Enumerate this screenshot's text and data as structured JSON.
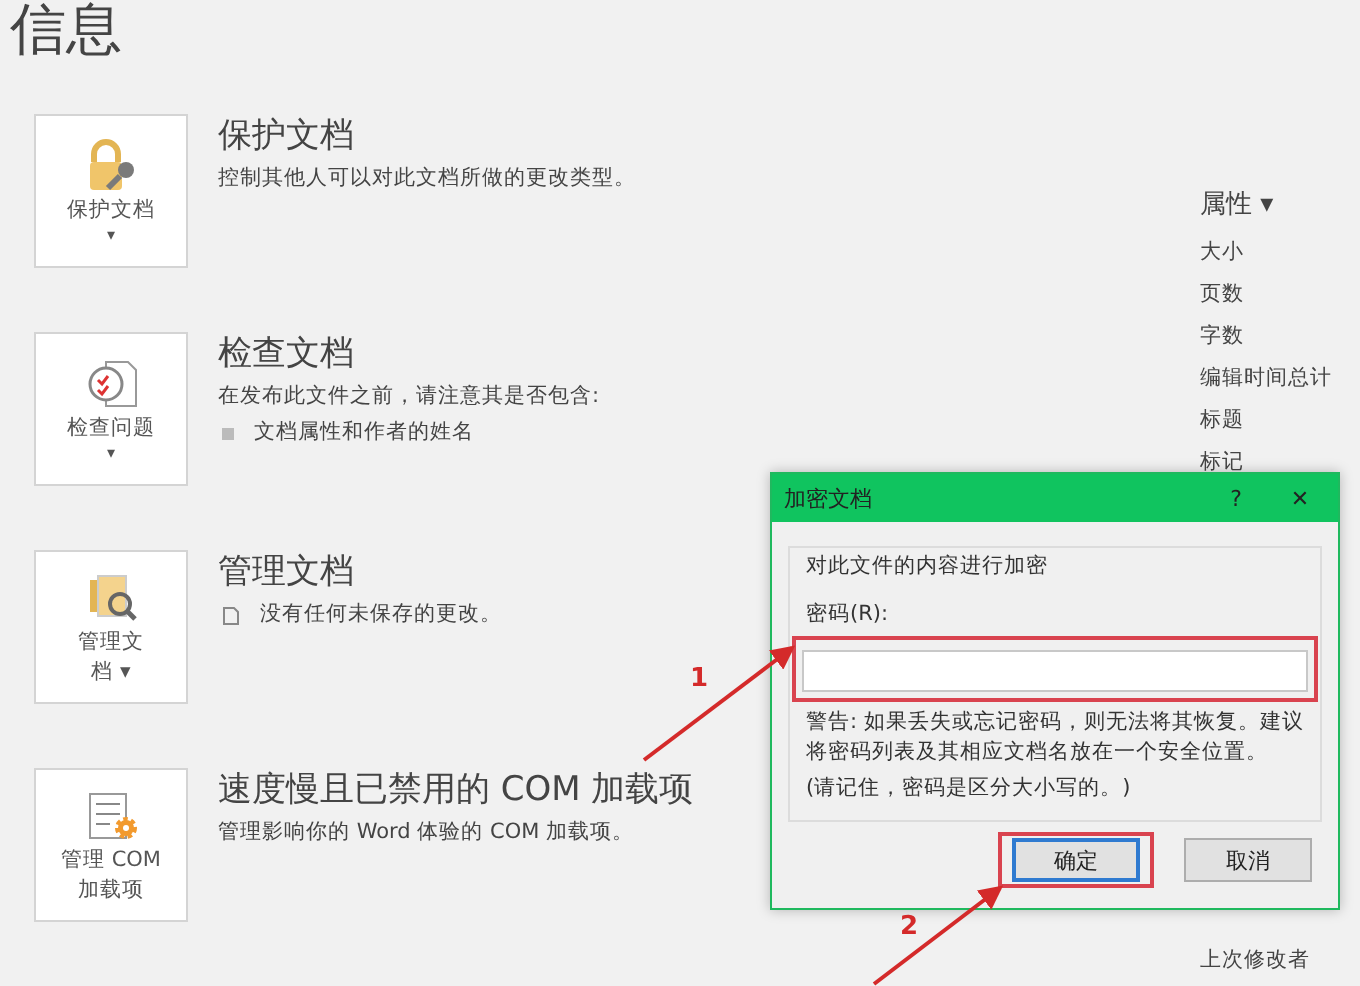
{
  "page_title": "信息",
  "sections": [
    {
      "kind": "protect",
      "button_lines": [
        "保护文档"
      ],
      "caret": "▾",
      "heading": "保护文档",
      "description": "控制其他人可以对此文档所做的更改类型。"
    },
    {
      "kind": "inspect",
      "button_lines": [
        "检查问题"
      ],
      "caret": "▾",
      "heading": "检查文档",
      "description": "在发布此文件之前，请注意其是否包含:",
      "bullets": [
        "文档属性和作者的姓名"
      ]
    },
    {
      "kind": "manage",
      "button_lines": [
        "管理文",
        "档 ▾"
      ],
      "heading": "管理文档",
      "note": "没有任何未保存的更改。"
    },
    {
      "kind": "com",
      "button_lines": [
        "管理 COM",
        "加载项"
      ],
      "heading": "速度慢且已禁用的 COM 加载项",
      "description": "管理影响你的 Word 体验的 COM 加载项。"
    }
  ],
  "properties": {
    "heading": "属性 ▾",
    "items": [
      "大小",
      "页数",
      "字数",
      "编辑时间总计",
      "标题",
      "标记"
    ],
    "last_item": "上次修改者"
  },
  "dialog": {
    "title": "加密文档",
    "help": "?",
    "close": "✕",
    "group_caption": "对此文件的内容进行加密",
    "field_label": "密码(R):",
    "warning": "警告: 如果丢失或忘记密码，则无法将其恢复。建议将密码列表及其相应文档名放在一个安全位置。",
    "reminder": "(请记住，密码是区分大小写的。)",
    "buttons": [
      {
        "label": "确定",
        "selected": true
      },
      {
        "label": "取消",
        "selected": false
      }
    ]
  },
  "annotations": [
    {
      "label": "1"
    },
    {
      "label": "2"
    }
  ]
}
